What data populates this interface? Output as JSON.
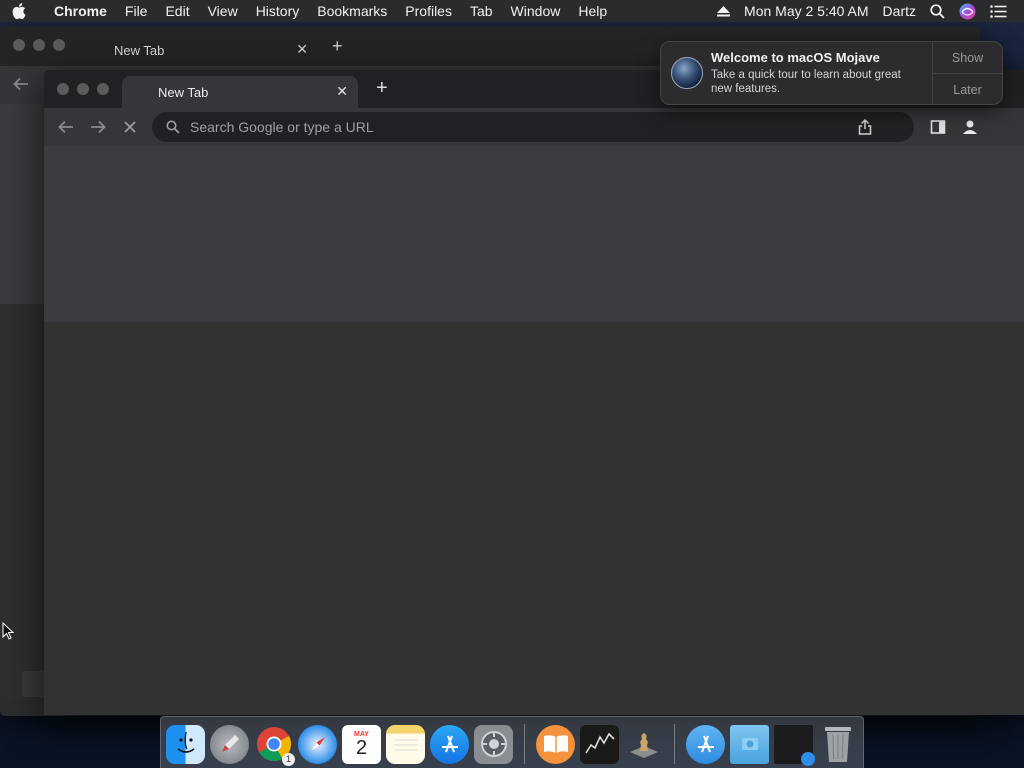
{
  "menubar": {
    "apple_icon": "apple-icon",
    "app_name": "Chrome",
    "menus": [
      "File",
      "Edit",
      "View",
      "History",
      "Bookmarks",
      "Profiles",
      "Tab",
      "Window",
      "Help"
    ],
    "datetime": "Mon May 2  5:40 AM",
    "user": "Dartz",
    "icons": [
      "eject-icon",
      "spotlight-search-icon",
      "siri-icon",
      "notification-center-icon"
    ]
  },
  "back_window": {
    "tab_title": "New Tab",
    "tab_close": "✕",
    "new_tab": "+"
  },
  "front_window": {
    "tab_title": "New Tab",
    "tab_close": "✕",
    "new_tab": "+",
    "omnibox_placeholder": "Search Google or type a URL"
  },
  "notification": {
    "title": "Welcome to macOS Mojave",
    "body": "Take a quick tour to learn about great new features.",
    "actions": [
      "Show",
      "Later"
    ]
  },
  "dock": {
    "apps": [
      {
        "name": "Finder",
        "icon": "finder-icon",
        "running": true
      },
      {
        "name": "Launchpad",
        "icon": "launchpad-icon",
        "running": false
      },
      {
        "name": "Google Chrome",
        "icon": "chrome-icon",
        "running": true,
        "badge": "1"
      },
      {
        "name": "Safari",
        "icon": "safari-icon",
        "running": true
      },
      {
        "name": "Calendar",
        "icon": "calendar-icon",
        "running": false,
        "month": "MAY",
        "day": "2"
      },
      {
        "name": "Notes",
        "icon": "notes-icon",
        "running": false
      },
      {
        "name": "App Store",
        "icon": "app-store-icon",
        "running": false
      },
      {
        "name": "System Preferences",
        "icon": "system-preferences-icon",
        "running": false
      },
      {
        "name": "Books",
        "icon": "books-icon",
        "running": true
      },
      {
        "name": "Stocks",
        "icon": "stocks-icon",
        "running": false
      },
      {
        "name": "Chess",
        "icon": "chess-icon",
        "running": false
      },
      {
        "name": "Applications",
        "icon": "applications-folder-icon",
        "running": false
      },
      {
        "name": "Downloads",
        "icon": "downloads-folder-icon",
        "running": false
      },
      {
        "name": "Safari Window",
        "icon": "minimized-window-icon",
        "running": false
      },
      {
        "name": "Trash",
        "icon": "trash-icon",
        "running": false
      }
    ]
  },
  "colors": {
    "menubar_bg": "#2a2b2d",
    "window_bg": "#323232",
    "omnibox_bg": "#202124",
    "chrome_toolbar": "#35363a"
  }
}
